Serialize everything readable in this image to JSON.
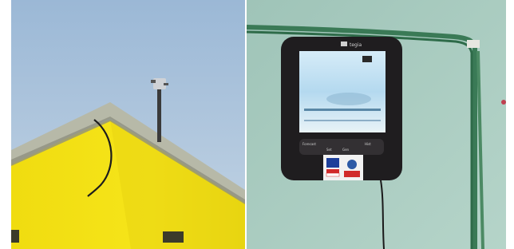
{
  "photos": [
    {
      "id_label": "weather-station-on-rooftop",
      "palette": {
        "sky": "#a9c2dc",
        "wall": "#f3e216",
        "wall_shadow": "#d8c90f",
        "roof_concrete": "#b6b8a6",
        "mast": "#3a3a3a"
      }
    },
    {
      "id_label": "wall-mounted-display-console",
      "palette": {
        "wall": "#a8ccc0",
        "device_body": "#1f1d1f",
        "screen": "#bfe0f1",
        "cable": "#3e7c5b"
      },
      "device": {
        "brand": "tegia",
        "button_labels": [
          "Forecast",
          "Set",
          "Gen",
          "Hist"
        ]
      }
    }
  ]
}
